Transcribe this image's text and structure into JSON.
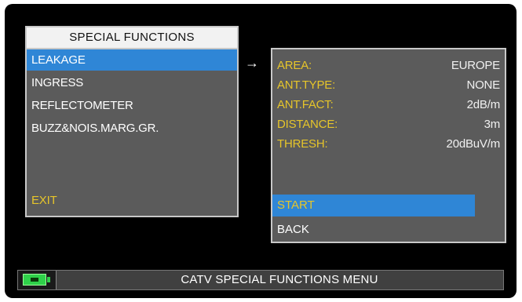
{
  "left_menu": {
    "title": "SPECIAL FUNCTIONS",
    "items": [
      {
        "label": "LEAKAGE",
        "selected": true
      },
      {
        "label": "INGRESS",
        "selected": false
      },
      {
        "label": "REFLECTOMETER",
        "selected": false
      },
      {
        "label": "BUZZ&NOIS.MARG.GR.",
        "selected": false
      }
    ],
    "exit_label": "EXIT"
  },
  "arrow": "→",
  "leakage_settings": {
    "params": [
      {
        "label": "AREA:",
        "value": "EUROPE"
      },
      {
        "label": "ANT.TYPE:",
        "value": "NONE"
      },
      {
        "label": "ANT.FACT:",
        "value": "2dB/m"
      },
      {
        "label": "DISTANCE:",
        "value": "3m"
      },
      {
        "label": "THRESH:",
        "value": "20dBuV/m"
      }
    ],
    "start_label": "START",
    "back_label": "BACK"
  },
  "status_bar": {
    "battery_icon": "battery-charging-icon",
    "text": "CATV SPECIAL FUNCTIONS MENU"
  },
  "colors": {
    "selection": "#2f86d6",
    "label_yellow": "#e6c52a",
    "panel_bg": "#5b5b5b",
    "battery_green": "#2fd14a"
  }
}
